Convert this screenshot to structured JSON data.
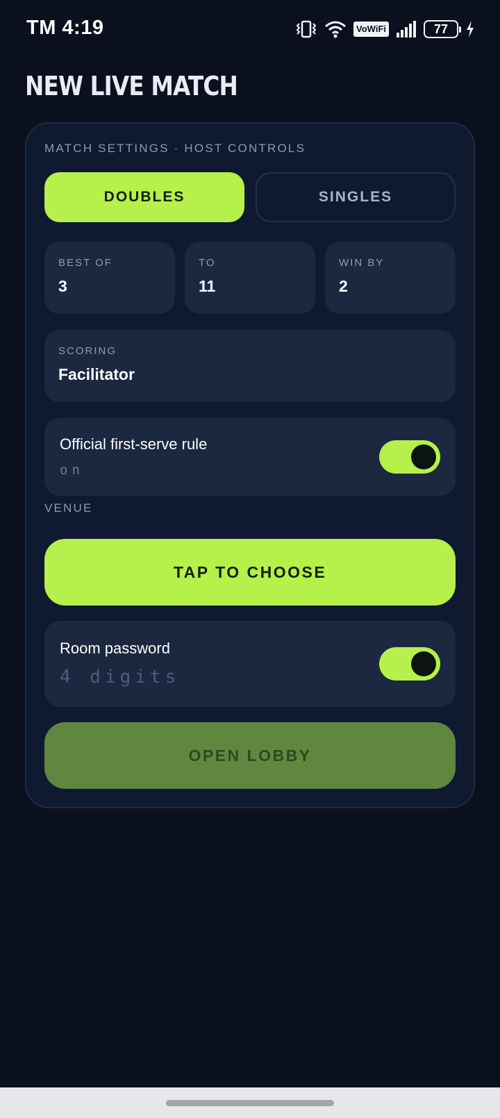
{
  "status_bar": {
    "time": "TM 4:19",
    "vowifi": "VoWiFi",
    "battery": "77"
  },
  "header": {
    "title": "NEW LIVE MATCH"
  },
  "settings": {
    "section_label": "MATCH SETTINGS · HOST CONTROLS",
    "mode_options": [
      {
        "label": "DOUBLES",
        "selected": true
      },
      {
        "label": "SINGLES",
        "selected": false
      }
    ],
    "stats": [
      {
        "label": "BEST OF",
        "value": "3"
      },
      {
        "label": "TO",
        "value": "11"
      },
      {
        "label": "WIN BY",
        "value": "2"
      }
    ],
    "scoring": {
      "label": "SCORING",
      "value": "Facilitator"
    },
    "first_serve": {
      "title": "Official first-serve rule",
      "state_text": "on",
      "enabled": true
    },
    "venue": {
      "label": "VENUE",
      "button": "TAP TO CHOOSE"
    },
    "room_password": {
      "title": "Room password",
      "placeholder": "4 digits",
      "enabled": true
    },
    "open_lobby": {
      "label": "OPEN LOBBY",
      "enabled": false
    }
  },
  "colors": {
    "accent": "#b6f04a",
    "background": "#0a101d",
    "card": "#0f1a30",
    "field": "#1c2840",
    "disabled_button": "#60873f"
  }
}
